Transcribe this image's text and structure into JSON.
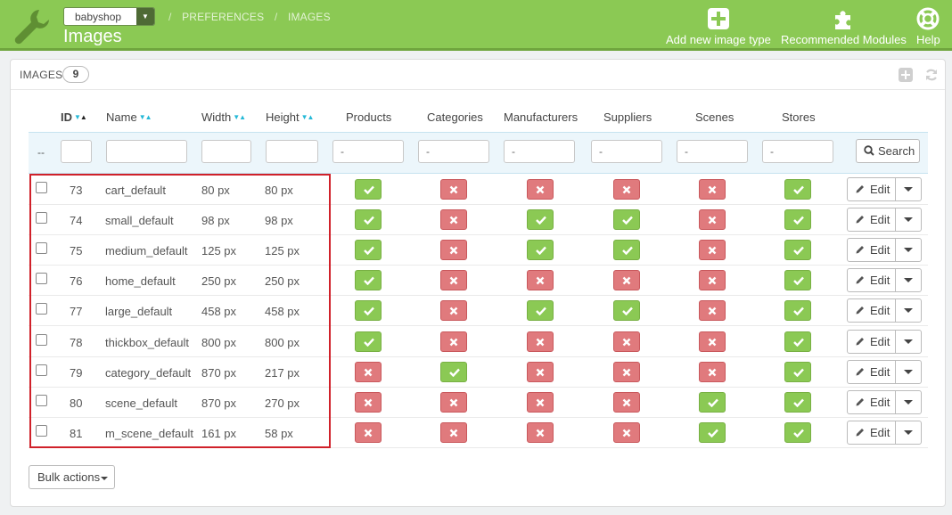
{
  "header": {
    "shop": "babyshop",
    "breadcrumb": [
      "PREFERENCES",
      "IMAGES"
    ],
    "breadcrumb_sep": "/",
    "title": "Images",
    "actions": [
      {
        "label": "Add new image type",
        "icon": "add-icon"
      },
      {
        "label": "Recommended Modules",
        "icon": "puzzle-icon"
      },
      {
        "label": "Help",
        "icon": "lifebuoy-icon"
      }
    ]
  },
  "panel": {
    "title": "IMAGES",
    "count": "9"
  },
  "columns": {
    "id": "ID",
    "name": "Name",
    "width": "Width",
    "height": "Height",
    "products": "Products",
    "categories": "Categories",
    "manufacturers": "Manufacturers",
    "suppliers": "Suppliers",
    "scenes": "Scenes",
    "stores": "Stores"
  },
  "filters": {
    "dash": "--",
    "products": "-",
    "categories": "-",
    "manufacturers": "-",
    "suppliers": "-",
    "scenes": "-",
    "stores": "-",
    "search_label": "Search"
  },
  "rows": [
    {
      "id": "73",
      "name": "cart_default",
      "width": "80 px",
      "height": "80 px",
      "flags": [
        true,
        false,
        false,
        false,
        false,
        true
      ]
    },
    {
      "id": "74",
      "name": "small_default",
      "width": "98 px",
      "height": "98 px",
      "flags": [
        true,
        false,
        true,
        true,
        false,
        true
      ]
    },
    {
      "id": "75",
      "name": "medium_default",
      "width": "125 px",
      "height": "125 px",
      "flags": [
        true,
        false,
        true,
        true,
        false,
        true
      ]
    },
    {
      "id": "76",
      "name": "home_default",
      "width": "250 px",
      "height": "250 px",
      "flags": [
        true,
        false,
        false,
        false,
        false,
        true
      ]
    },
    {
      "id": "77",
      "name": "large_default",
      "width": "458 px",
      "height": "458 px",
      "flags": [
        true,
        false,
        true,
        true,
        false,
        true
      ]
    },
    {
      "id": "78",
      "name": "thickbox_default",
      "width": "800 px",
      "height": "800 px",
      "flags": [
        true,
        false,
        false,
        false,
        false,
        true
      ]
    },
    {
      "id": "79",
      "name": "category_default",
      "width": "870 px",
      "height": "217 px",
      "flags": [
        false,
        true,
        false,
        false,
        false,
        true
      ]
    },
    {
      "id": "80",
      "name": "scene_default",
      "width": "870 px",
      "height": "270 px",
      "flags": [
        false,
        false,
        false,
        false,
        true,
        true
      ]
    },
    {
      "id": "81",
      "name": "m_scene_default",
      "width": "161 px",
      "height": "58 px",
      "flags": [
        false,
        false,
        false,
        false,
        true,
        true
      ]
    }
  ],
  "edit_label": "Edit",
  "bulk_label": "Bulk actions",
  "colors": {
    "header_green": "#8bc954",
    "ok": "#8bc954",
    "no": "#e07a7d",
    "highlight": "#d0212a"
  }
}
